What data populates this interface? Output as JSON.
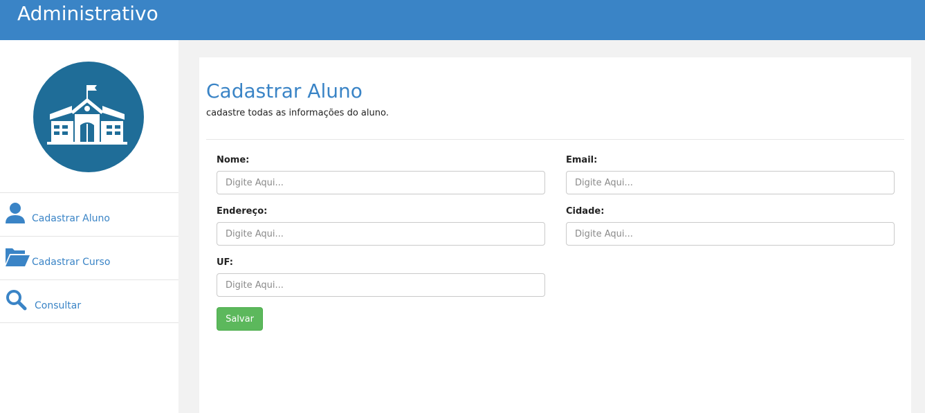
{
  "header": {
    "title": "Administrativo"
  },
  "sidebar": {
    "logo_icon": "school-building-icon",
    "items": [
      {
        "label": "Cadastrar Aluno",
        "icon": "user-icon"
      },
      {
        "label": "Cadastrar Curso",
        "icon": "folder-open-icon"
      },
      {
        "label": "Consultar",
        "icon": "search-icon"
      }
    ]
  },
  "form": {
    "title": "Cadastrar Aluno",
    "subtitle": "cadastre todas as informações do aluno.",
    "fields": {
      "nome": {
        "label": "Nome:",
        "placeholder": "Digite Aqui...",
        "value": ""
      },
      "email": {
        "label": "Email:",
        "placeholder": "Digite Aqui...",
        "value": ""
      },
      "endereco": {
        "label": "Endereço:",
        "placeholder": "Digite Aqui...",
        "value": ""
      },
      "cidade": {
        "label": "Cidade:",
        "placeholder": "Digite Aqui...",
        "value": ""
      },
      "uf": {
        "label": "UF:",
        "placeholder": "Digite Aqui...",
        "value": ""
      }
    },
    "save_label": "Salvar"
  },
  "colors": {
    "header": "#3a84c6",
    "accent": "#3a84c6",
    "logo_bg": "#1f6d98",
    "save_button": "#5cb85c",
    "page_bg": "#f2f2f2"
  }
}
